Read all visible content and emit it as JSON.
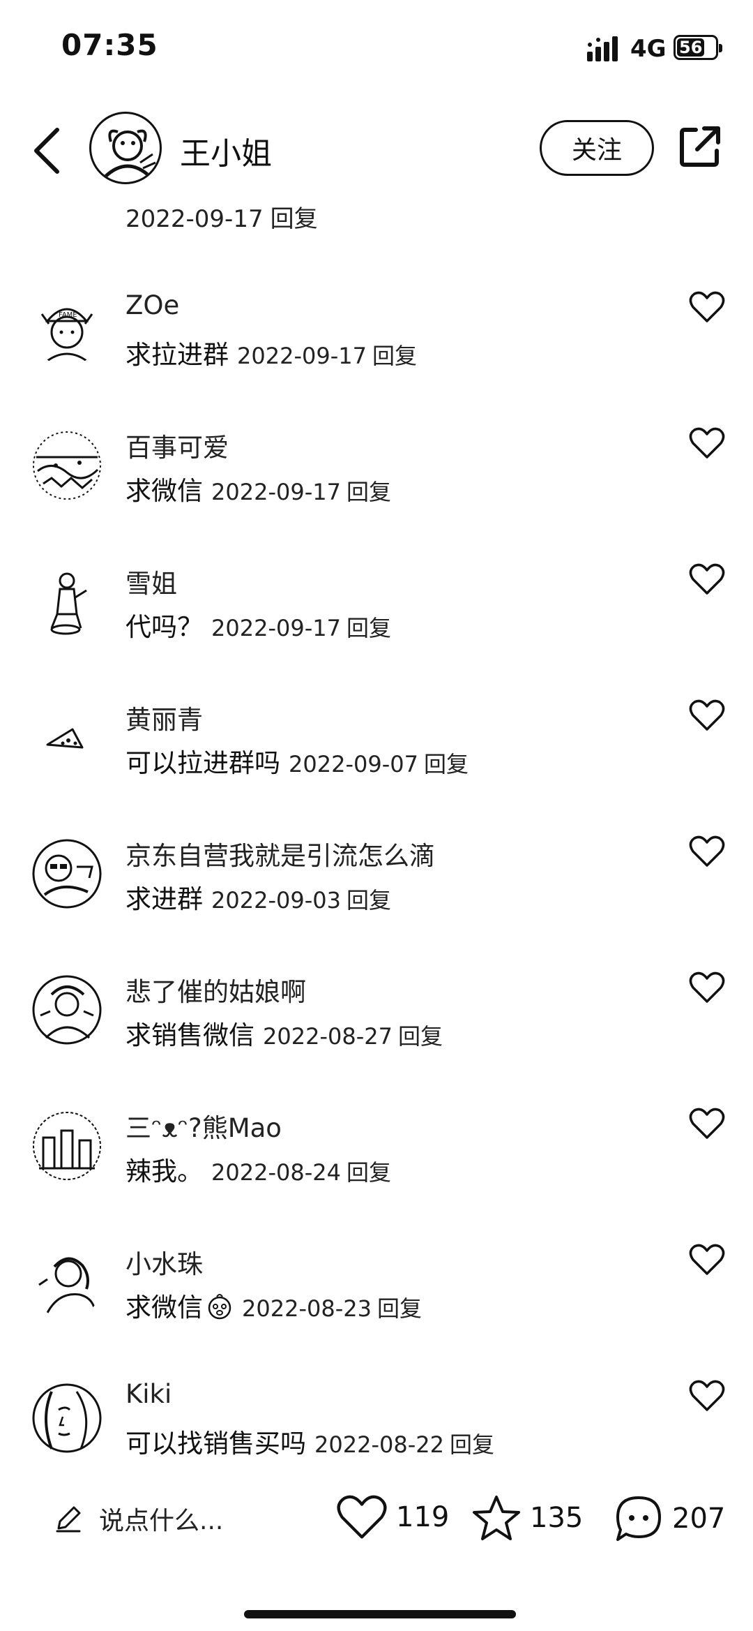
{
  "status_bar": {
    "time": "07:35",
    "network": "4G",
    "battery": "56"
  },
  "header": {
    "author": "王小姐",
    "follow_label": "关注"
  },
  "previous_comment_meta": {
    "date": "2022-09-17",
    "reply": "回复"
  },
  "comments": [
    {
      "name": "ZOe",
      "text": "求拉进群",
      "date": "2022-09-17",
      "reply": "回复"
    },
    {
      "name": "百事可爱",
      "text": "求微信",
      "date": "2022-09-17",
      "reply": "回复"
    },
    {
      "name": "雪姐",
      "text": "代吗？",
      "date": "2022-09-17",
      "reply": "回复"
    },
    {
      "name": "黄丽青",
      "text": "可以拉进群吗",
      "date": "2022-09-07",
      "reply": "回复"
    },
    {
      "name": "京东自营我就是引流怎么滴",
      "text": "求进群",
      "date": "2022-09-03",
      "reply": "回复"
    },
    {
      "name": "悲了催的姑娘啊",
      "text": "求销售微信",
      "date": "2022-08-27",
      "reply": "回复"
    },
    {
      "name": "三ᵔᴥᵔ?熊Mao",
      "text": "辣我。",
      "date": "2022-08-24",
      "reply": "回复"
    },
    {
      "name": "小水珠",
      "text": "求微信",
      "date": "2022-08-23",
      "reply": "回复"
    },
    {
      "name": "Kiki",
      "text": "可以找销售买吗",
      "date": "2022-08-22",
      "reply": "回复"
    }
  ],
  "bottom_bar": {
    "compose_placeholder": "说点什么...",
    "likes": "119",
    "favorites": "135",
    "comments": "207"
  },
  "icons": [
    "back-arrow-icon",
    "share-icon",
    "heart-icon",
    "star-icon",
    "comment-bubble-icon",
    "pencil-icon"
  ]
}
